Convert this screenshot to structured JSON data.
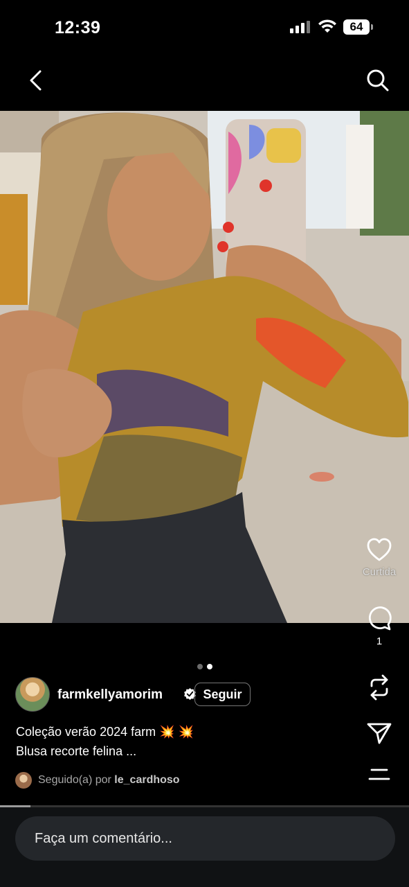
{
  "status_bar": {
    "time": "12:39",
    "battery": "64",
    "icons": [
      "signal-icon",
      "wifi-icon",
      "battery-icon"
    ]
  },
  "nav": {
    "back_icon": "chevron-left-icon",
    "search_icon": "search-icon"
  },
  "post": {
    "carousel": {
      "total": 2,
      "active_index": 1
    },
    "actions": {
      "like_label": "Curtida",
      "comment_count": "1",
      "icons": [
        "heart-icon",
        "comment-icon",
        "repost-icon",
        "share-icon",
        "more-icon"
      ]
    },
    "author": {
      "username": "farmkellyamorim",
      "verified": true,
      "follow_label": "Seguir"
    },
    "caption": {
      "line1": "Coleção verão 2024 farm",
      "emoji": "💥 💥",
      "line2": "Blusa recorte felina ..."
    },
    "followed": {
      "prefix": "Seguido(a) por",
      "user": "le_cardhoso"
    },
    "progress": 0.075
  },
  "comment": {
    "placeholder": "Faça um comentário..."
  },
  "colors": {
    "background": "#000000",
    "bottom_bar": "#101214",
    "input_bg": "#24272b",
    "accent_red": "#e0342a"
  }
}
